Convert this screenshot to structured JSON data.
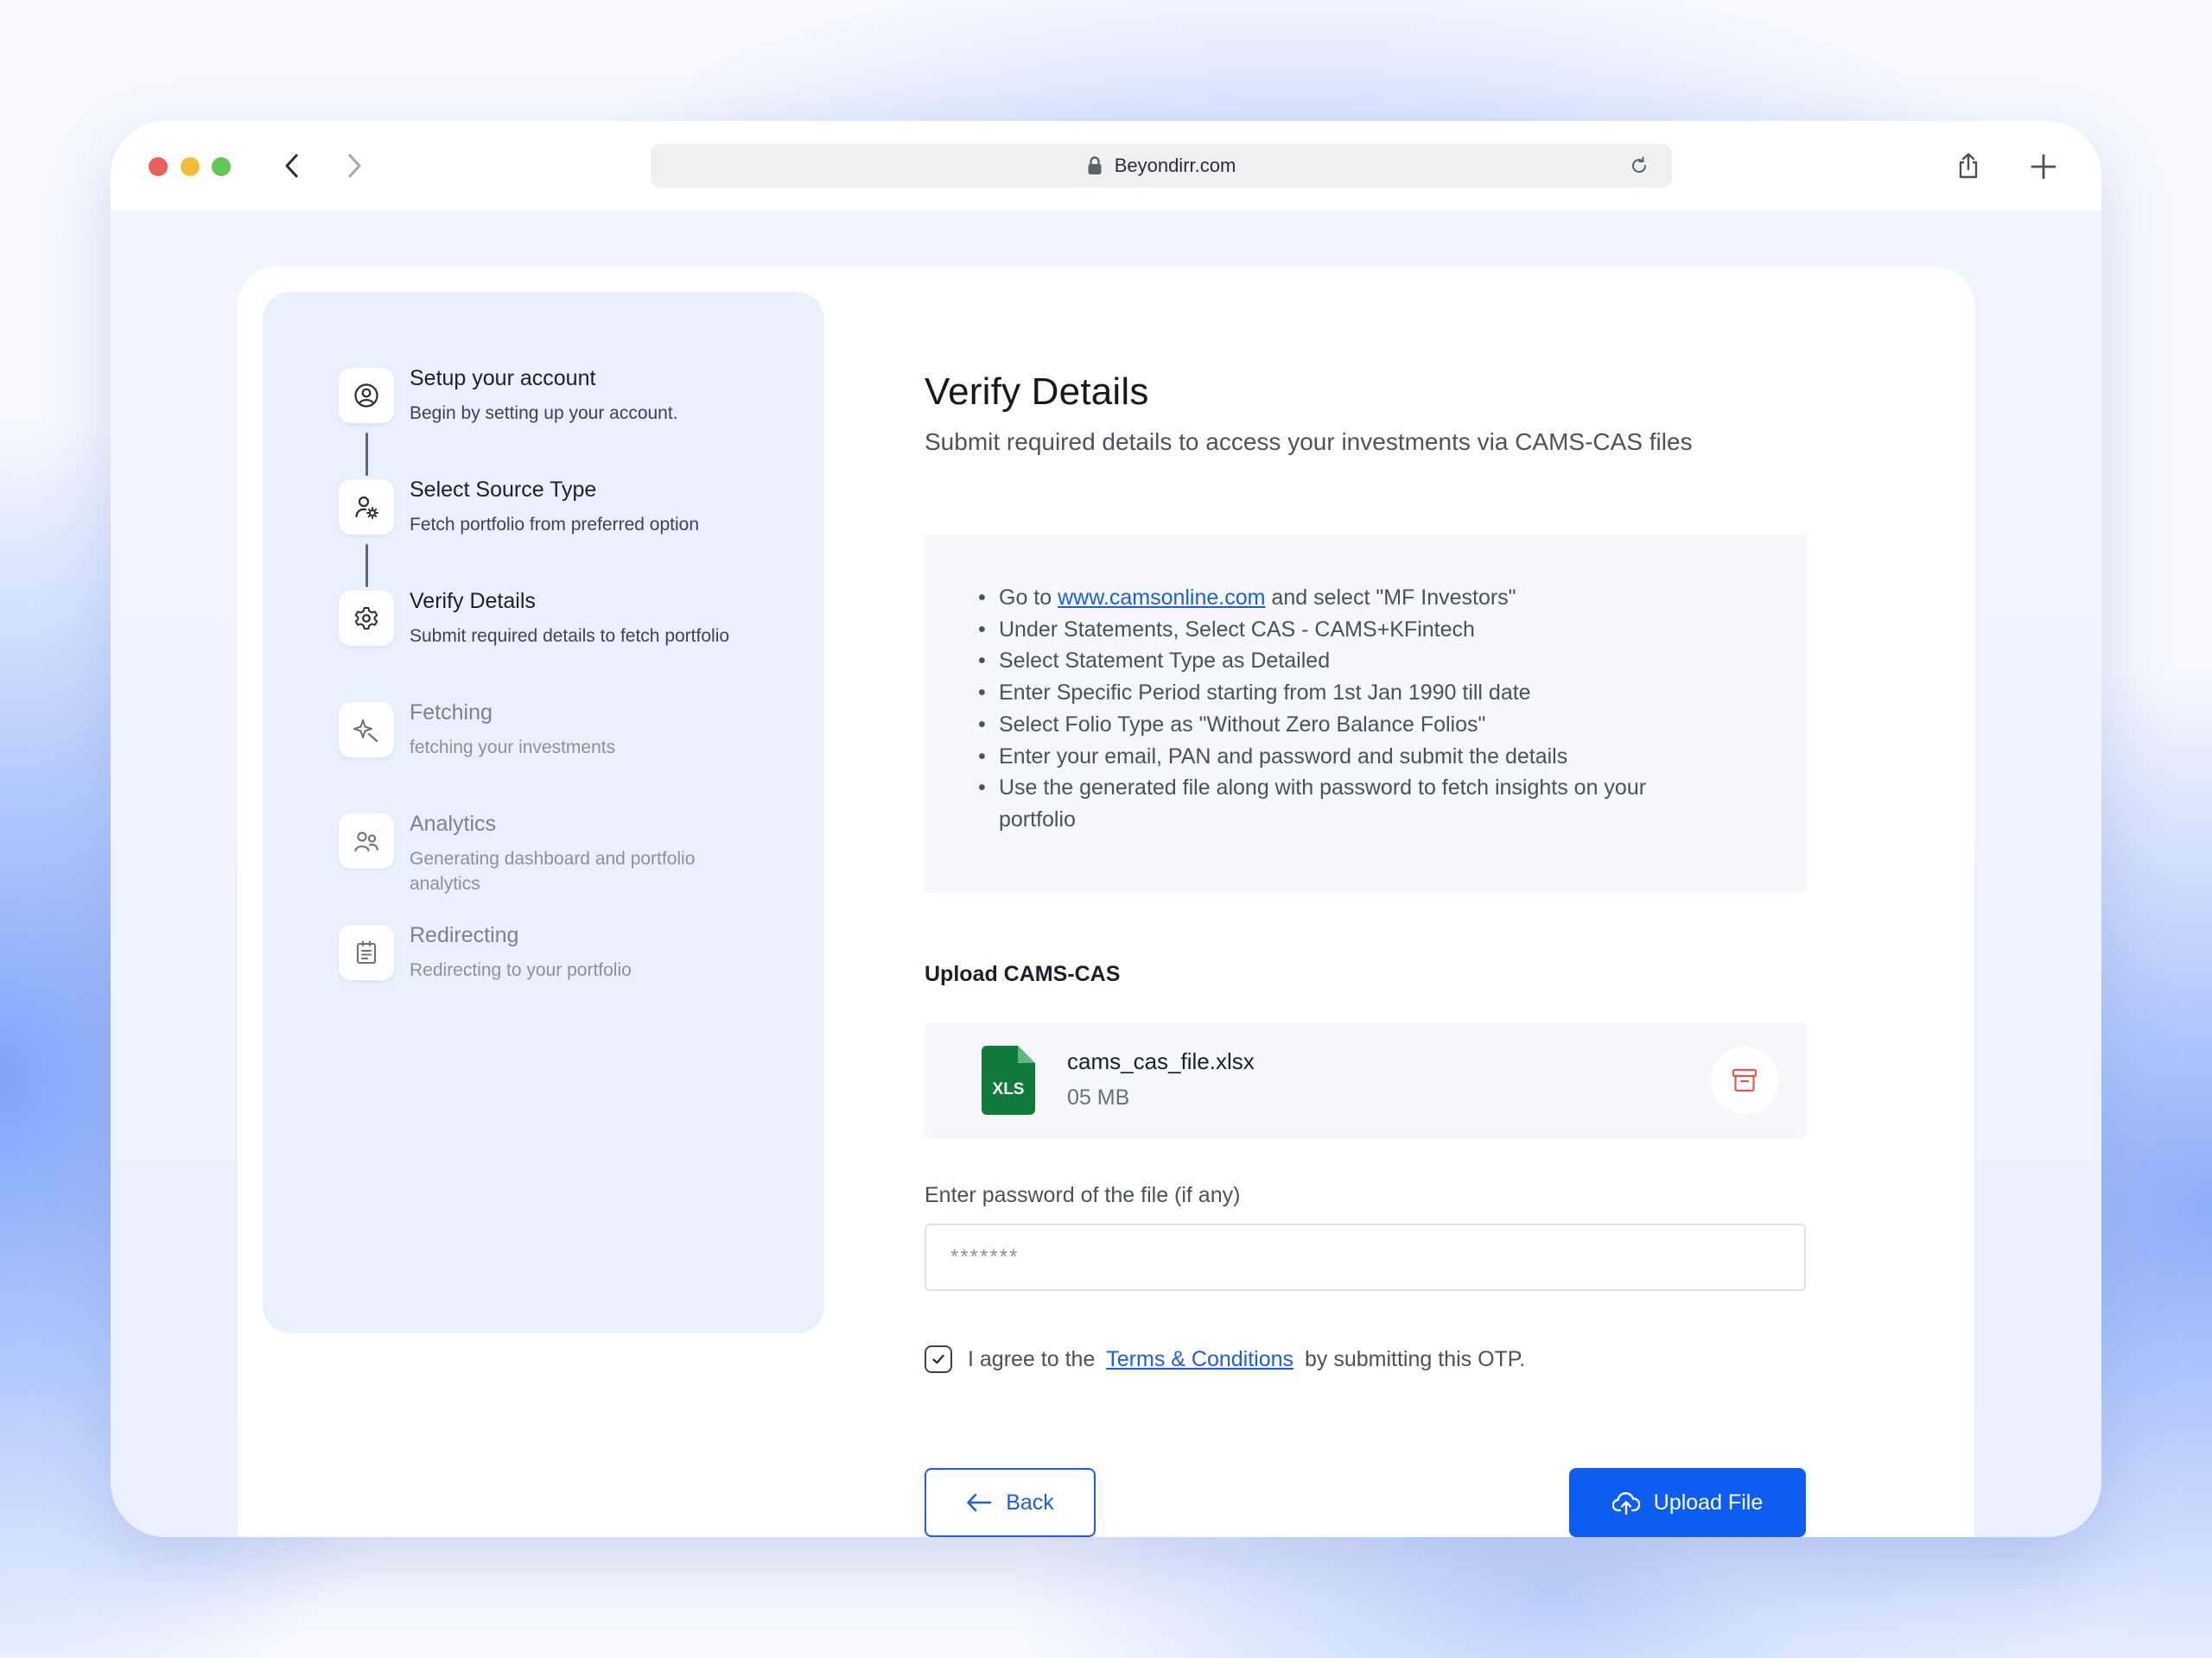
{
  "browser": {
    "url": "Beyondirr.com"
  },
  "sidebar": {
    "steps": [
      {
        "title": "Setup your account",
        "desc": "Begin by setting up your account.",
        "icon": "user-circle-icon",
        "state": "done"
      },
      {
        "title": "Select Source Type",
        "desc": "Fetch portfolio from preferred option",
        "icon": "user-settings-icon",
        "state": "done"
      },
      {
        "title": "Verify Details",
        "desc": "Submit required details to fetch portfolio",
        "icon": "gear-icon",
        "state": "active"
      },
      {
        "title": "Fetching",
        "desc": "fetching your investments",
        "icon": "sparkle-icon",
        "state": "pending"
      },
      {
        "title": "Analytics",
        "desc": "Generating dashboard and portfolio analytics",
        "icon": "users-icon",
        "state": "pending"
      },
      {
        "title": "Redirecting",
        "desc": "Redirecting to your portfolio",
        "icon": "clipboard-icon",
        "state": "pending"
      }
    ]
  },
  "main": {
    "title": "Verify Details",
    "subtitle": "Submit required details to access your investments via CAMS-CAS files",
    "instructions": {
      "first_prefix": "Go to",
      "first_link": "www.camsonline.com",
      "first_suffix": "and select \"MF Investors\"",
      "items": [
        "Under Statements, Select CAS - CAMS+KFintech",
        "Select Statement Type as Detailed",
        "Enter Specific Period starting from 1st Jan 1990 till date",
        "Select Folio Type as \"Without Zero Balance Folios\"",
        "Enter your email, PAN and password and submit the details",
        "Use the generated file along with password to fetch insights on your portfolio"
      ]
    },
    "upload_label": "Upload CAMS-CAS",
    "file": {
      "badge": "XLS",
      "name": "cams_cas_file.xlsx",
      "size": "05 MB"
    },
    "password_label": "Enter password of the file (if any)",
    "password_placeholder": "*******",
    "agree": {
      "prefix": "I agree to the",
      "link": "Terms & Conditions",
      "suffix": "by submitting this OTP.",
      "checked": true
    },
    "back_label": "Back",
    "upload_button_label": "Upload File"
  },
  "colors": {
    "accent": "#0d5ef0",
    "link": "#1c5fd6",
    "sidebar_bg": "#eaf1fe",
    "xls_green": "#0f7a3c",
    "delete_red": "#e05a4f"
  }
}
